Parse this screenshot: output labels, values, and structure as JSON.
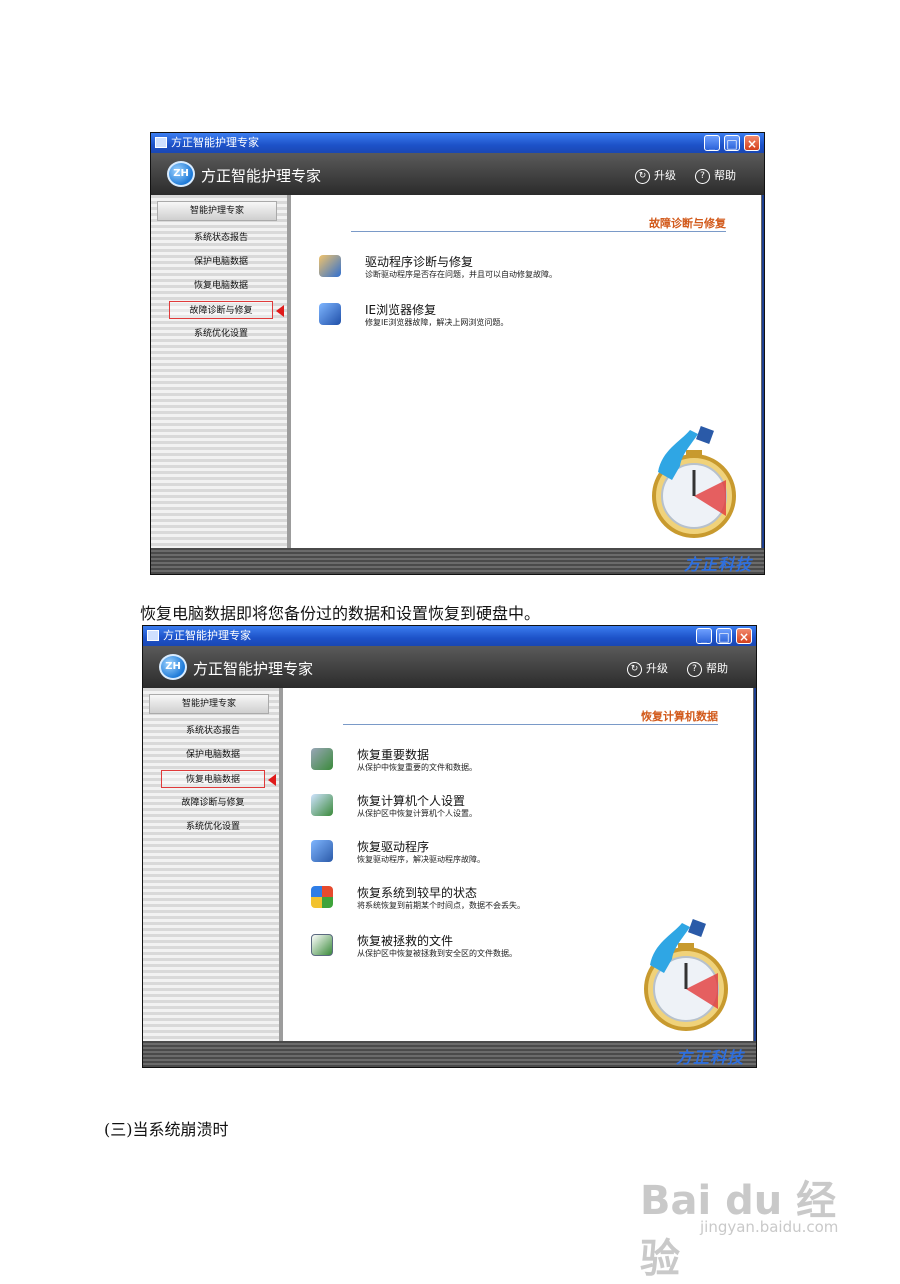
{
  "window1": {
    "title": "方正智能护理专家",
    "app_title": "方正智能护理专家",
    "logo": "ZH",
    "header_links": [
      {
        "label": "升级",
        "icon": "update-icon"
      },
      {
        "label": "帮助",
        "icon": "help-icon"
      }
    ],
    "nav_header": "智能护理专家",
    "nav_items": [
      "系统状态报告",
      "保护电脑数据",
      "恢复电脑数据",
      "故障诊断与修复",
      "系统优化设置"
    ],
    "active_index": 3,
    "section_title": "故障诊断与修复",
    "items": [
      {
        "title": "驱动程序诊断与修复",
        "desc": "诊断驱动程序是否存在问题，并且可以自动修复故障。",
        "icon": "driver-repair-icon"
      },
      {
        "title": "IE浏览器修复",
        "desc": "修复IE浏览器故障，解决上网浏览问题。",
        "icon": "ie-repair-icon"
      }
    ],
    "brand": "方正科技"
  },
  "caption": "恢复电脑数据即将您备份过的数据和设置恢复到硬盘中。",
  "window2": {
    "title": "方正智能护理专家",
    "app_title": "方正智能护理专家",
    "logo": "ZH",
    "header_links": [
      {
        "label": "升级",
        "icon": "update-icon"
      },
      {
        "label": "帮助",
        "icon": "help-icon"
      }
    ],
    "nav_header": "智能护理专家",
    "nav_items": [
      "系统状态报告",
      "保护电脑数据",
      "恢复电脑数据",
      "故障诊断与修复",
      "系统优化设置"
    ],
    "active_index": 2,
    "section_title": "恢复计算机数据",
    "items": [
      {
        "title": "恢复重要数据",
        "desc": "从保护中恢复重要的文件和数据。",
        "icon": "restore-data-icon"
      },
      {
        "title": "恢复计算机个人设置",
        "desc": "从保护区中恢复计算机个人设置。",
        "icon": "restore-settings-icon"
      },
      {
        "title": "恢复驱动程序",
        "desc": "恢复驱动程序，解决驱动程序故障。",
        "icon": "restore-driver-icon"
      },
      {
        "title": "恢复系统到较早的状态",
        "desc": "将系统恢复到前期某个时间点，数据不会丢失。",
        "icon": "windows-icon"
      },
      {
        "title": "恢复被拯救的文件",
        "desc": "从保护区中恢复被拯救到安全区的文件数据。",
        "icon": "rescued-file-icon"
      }
    ],
    "brand": "方正科技"
  },
  "heading": "(三)当系统崩溃时",
  "watermark": {
    "logo": "Bai du 经验",
    "url": "jingyan.baidu.com"
  }
}
